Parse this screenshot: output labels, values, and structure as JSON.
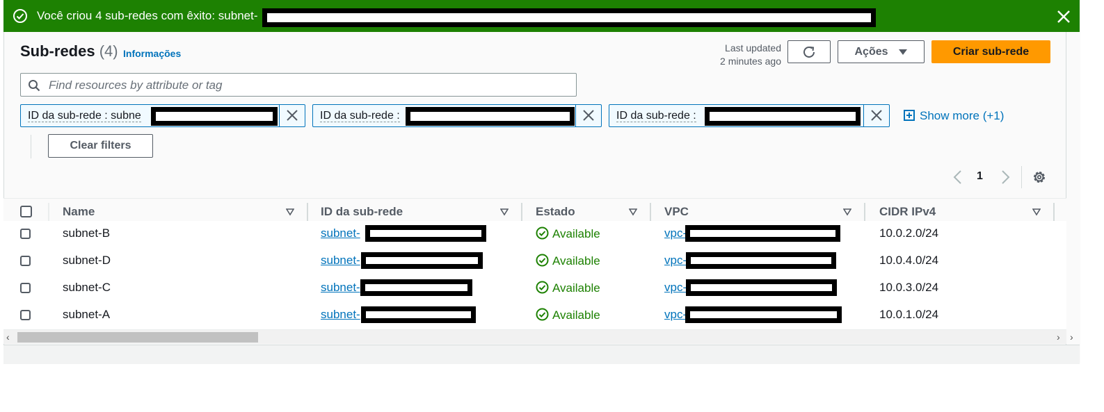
{
  "banner": {
    "message": "Você criou 4 sub-redes com êxito: subnet-",
    "bg_color": "#1d8102",
    "icon": "check-circle-icon",
    "close_icon": "close-icon"
  },
  "header": {
    "title": "Sub-redes",
    "count": "(4)",
    "info_link": "Informações",
    "last_updated_line1": "Last updated",
    "last_updated_line2": "2 minutes ago",
    "refresh_icon": "refresh-icon",
    "actions_label": "Ações",
    "create_label": "Criar sub-rede",
    "accent_color": "#ff9900"
  },
  "search": {
    "placeholder": "Find resources by attribute or tag",
    "icon": "search-icon"
  },
  "filters": {
    "tokens": [
      {
        "label": "ID da sub-rede : subne"
      },
      {
        "label": "ID da sub-rede :"
      },
      {
        "label": "ID da sub-rede :"
      }
    ],
    "show_more": "Show more (+1)",
    "clear_filters": "Clear filters"
  },
  "pagination": {
    "current_page": "1"
  },
  "table": {
    "columns": [
      "Name",
      "ID da sub-rede",
      "Estado",
      "VPC",
      "CIDR IPv4"
    ],
    "rows": [
      {
        "name": "subnet-B",
        "subnet_id": "subnet-",
        "state": "Available",
        "vpc": "vpc-",
        "cidr": "10.0.2.0/24"
      },
      {
        "name": "subnet-D",
        "subnet_id": "subnet-",
        "state": "Available",
        "vpc": "vpc-",
        "cidr": "10.0.4.0/24"
      },
      {
        "name": "subnet-C",
        "subnet_id": "subnet-",
        "state": "Available",
        "vpc": "vpc-",
        "cidr": "10.0.3.0/24"
      },
      {
        "name": "subnet-A",
        "subnet_id": "subnet-",
        "state": "Available",
        "vpc": "vpc-",
        "cidr": "10.0.1.0/24"
      }
    ]
  }
}
